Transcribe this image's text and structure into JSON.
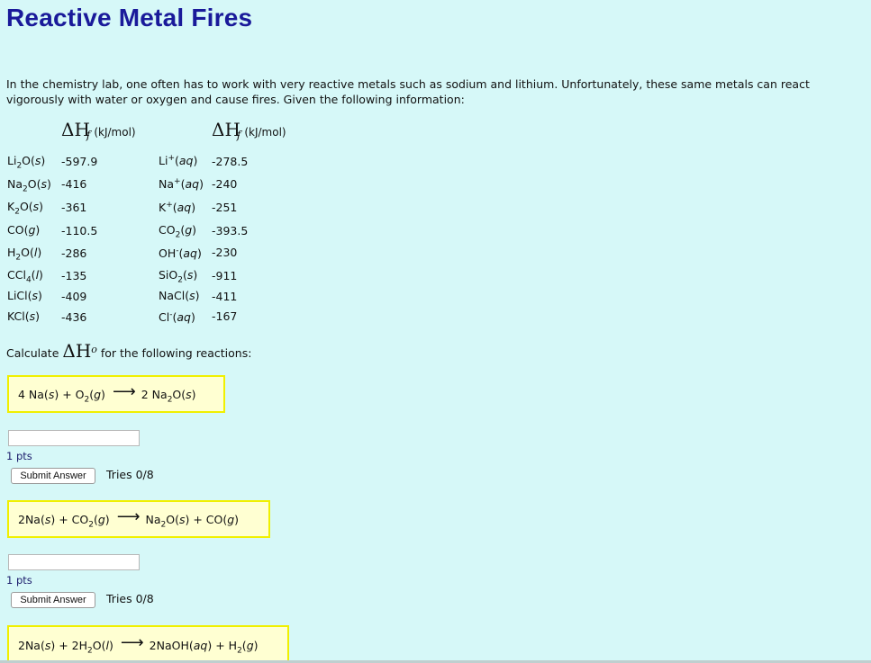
{
  "title": "Reactive Metal Fires",
  "intro": "In the chemistry lab, one often has to work with very reactive metals such as sodium and lithium. Unfortunately, these same metals can react vigorously with water or oxygen and cause fires. Given the following information:",
  "table_header": {
    "symbol": "ΔH",
    "sub": "f",
    "unit": "(kJ/mol)"
  },
  "left_column": [
    {
      "value": "-597.9"
    },
    {
      "value": "-416"
    },
    {
      "value": "-361"
    },
    {
      "value": "-110.5"
    },
    {
      "value": "-286"
    },
    {
      "value": "-135"
    },
    {
      "value": "-409"
    },
    {
      "value": "-436"
    }
  ],
  "right_column": [
    {
      "value": "-278.5"
    },
    {
      "value": "-240"
    },
    {
      "value": "-251"
    },
    {
      "value": "-393.5"
    },
    {
      "value": "-230"
    },
    {
      "value": "-911"
    },
    {
      "value": "-411"
    },
    {
      "value": "-167"
    }
  ],
  "calculate": {
    "before": "Calculate",
    "symbol": "ΔH",
    "after": "for the following reactions:"
  },
  "questions": [
    {
      "pts": "1 pts",
      "button": "Submit Answer",
      "tries": "Tries 0/8",
      "answer": ""
    },
    {
      "pts": "1 pts",
      "button": "Submit Answer",
      "tries": "Tries 0/8",
      "answer": ""
    },
    {
      "pts": "",
      "button": "",
      "tries": "",
      "answer": ""
    }
  ]
}
